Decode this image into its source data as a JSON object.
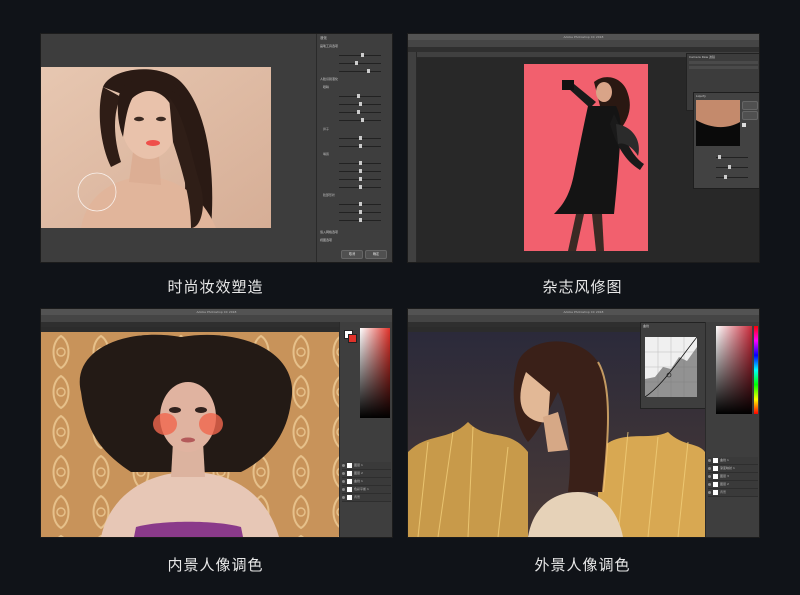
{
  "cards": [
    {
      "caption": "时尚妆效塑造",
      "panel_title": "液化",
      "sections": [
        "画笔工具选项",
        "人脸识别液化",
        "眼睛",
        "鼻子",
        "嘴唇",
        "脸部形状",
        "载入网格选项",
        "视图选项"
      ],
      "ok_label": "确定",
      "cancel_label": "取消"
    },
    {
      "caption": "杂志风修图",
      "window_title": "Adobe Photoshop CC 2018",
      "panel_title": "Camera Raw 滤镜",
      "dialog_title": "Liquify"
    },
    {
      "caption": "内景人像调色",
      "window_title": "Adobe Photoshop CC 2018",
      "layers": [
        "图层 1",
        "图层 2",
        "曲线 1",
        "色彩平衡 1",
        "背景"
      ]
    },
    {
      "caption": "外景人像调色",
      "window_title": "Adobe Photoshop CC 2018",
      "panel_title": "曲线",
      "layers": [
        "曲线 1",
        "渐变映射 1",
        "图层 3",
        "图层 2",
        "背景"
      ]
    }
  ],
  "colors": {
    "background": "#101318",
    "ps_dark": "#3a3a3a",
    "magazine_pink": "#f2606e",
    "caption": "#e8e8e8"
  }
}
